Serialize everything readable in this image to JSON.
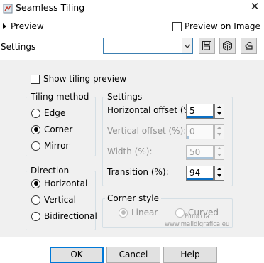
{
  "window": {
    "title": "Seamless Tiling"
  },
  "preview": {
    "label": "Preview",
    "on_image_label": "Preview on Image"
  },
  "presets": {
    "label": "Settings",
    "value": ""
  },
  "show_tiling_preview": {
    "label": "Show tiling preview",
    "checked": false
  },
  "tiling_method": {
    "title": "Tiling method",
    "options": [
      {
        "label": "Edge",
        "selected": false
      },
      {
        "label": "Corner",
        "selected": true
      },
      {
        "label": "Mirror",
        "selected": false
      }
    ]
  },
  "direction": {
    "title": "Direction",
    "options": [
      {
        "label": "Horizontal",
        "selected": true
      },
      {
        "label": "Vertical",
        "selected": false
      },
      {
        "label": "Bidirectional",
        "selected": false
      }
    ]
  },
  "settings": {
    "title": "Settings",
    "fields": [
      {
        "label": "Horizontal offset (%):",
        "value": "5",
        "enabled": true
      },
      {
        "label": "Vertical offset (%):",
        "value": "0",
        "enabled": false
      },
      {
        "label": "Width (%):",
        "value": "50",
        "enabled": false
      },
      {
        "label": "Transition (%):",
        "value": "94",
        "enabled": true
      }
    ]
  },
  "corner_style": {
    "title": "Corner style",
    "options": [
      {
        "label": "Linear",
        "selected": true,
        "enabled": false
      },
      {
        "label": "Curved",
        "selected": false,
        "enabled": false
      }
    ]
  },
  "watermark": {
    "line1": "Pinuccia",
    "line2": "www.maildigrafica.eu"
  },
  "buttons": {
    "ok": "OK",
    "cancel": "Cancel",
    "help": "Help"
  }
}
